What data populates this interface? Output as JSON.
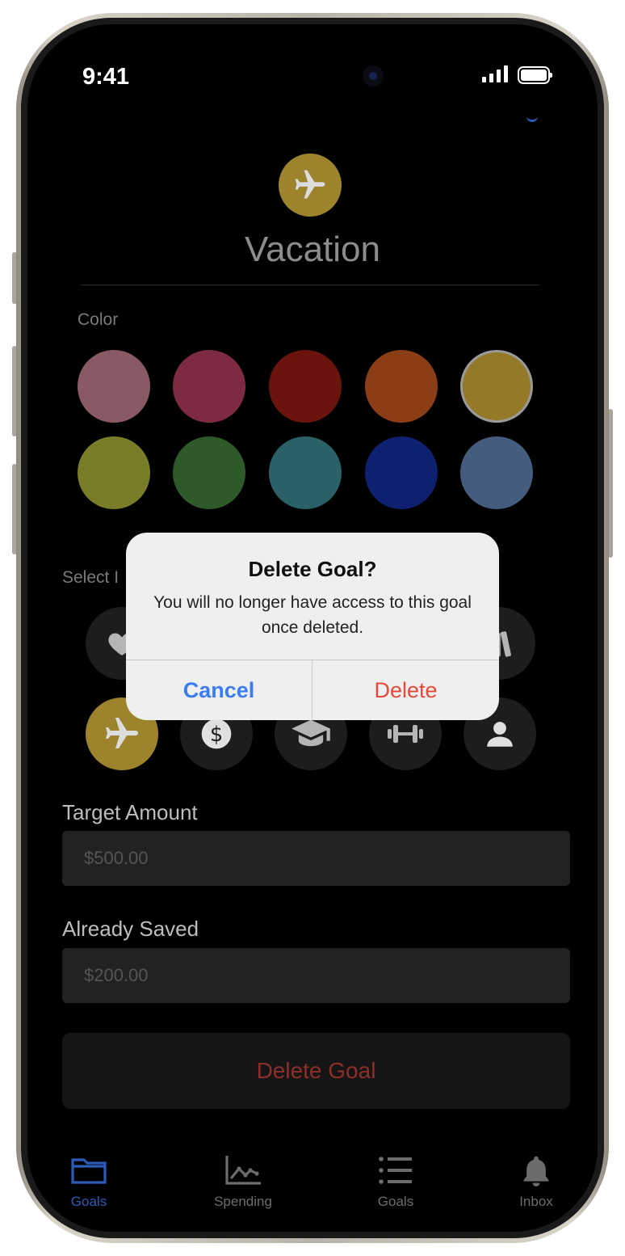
{
  "status_bar": {
    "time": "9:41"
  },
  "goal": {
    "name": "Vacation",
    "icon": "airplane-icon",
    "color": "#9d832b"
  },
  "color_section": {
    "label": "Color",
    "swatches": [
      "#8a5a64",
      "#7e2a40",
      "#6b140e",
      "#8b3d16",
      "#947a28",
      "#7a7d27",
      "#2e5a2a",
      "#2b6066",
      "#0d2170",
      "#445d7f"
    ],
    "selected_index": 4
  },
  "icon_section": {
    "label": "Select Icon",
    "label_visible": "Select I",
    "icons_row1": [
      "heart-icon",
      "books-icon"
    ],
    "icons_row2": [
      "airplane-icon",
      "dollar-icon",
      "graduation-cap-icon",
      "dumbbell-icon",
      "person-icon"
    ],
    "selected": "airplane-icon"
  },
  "target_amount": {
    "label": "Target Amount",
    "placeholder": "$500.00"
  },
  "already_saved": {
    "label": "Already Saved",
    "placeholder": "$200.00"
  },
  "delete_goal_label": "Delete Goal",
  "tabs": [
    {
      "label": "Goals",
      "icon": "folder-icon",
      "active": true
    },
    {
      "label": "Spending",
      "icon": "chart-icon",
      "active": false
    },
    {
      "label": "Goals",
      "icon": "list-icon",
      "active": false
    },
    {
      "label": "Inbox",
      "icon": "bell-icon",
      "active": false
    }
  ],
  "alert": {
    "title": "Delete Goal?",
    "message": "You will no longer have access to this goal once deleted.",
    "cancel_label": "Cancel",
    "delete_label": "Delete"
  },
  "colors": {
    "accent": "#3b7cf0",
    "destructive": "#e5493a",
    "selected_tab": "#2d5bb8"
  }
}
